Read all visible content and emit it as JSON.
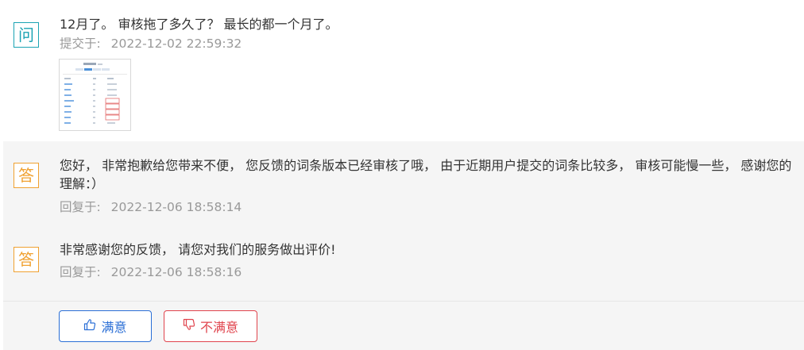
{
  "question": {
    "badge": "问",
    "text": "12月了。 审核拖了多久了？ 最长的都一个月了。",
    "submitted_label": "提交于:",
    "submitted_time": "2022-12-02 22:59:32"
  },
  "answers": [
    {
      "badge": "答",
      "text": "您好， 非常抱歉给您带来不便， 您反馈的词条版本已经审核了哦， 由于近期用户提交的词条比较多， 审核可能慢一些， 感谢您的理解：）",
      "replied_label": "回复于:",
      "replied_time": "2022-12-06 18:58:14"
    },
    {
      "badge": "答",
      "text": "非常感谢您的反馈， 请您对我们的服务做出评价!",
      "replied_label": "回复于:",
      "replied_time": "2022-12-06 18:58:16"
    }
  ],
  "rating": {
    "satisfied_label": "满意",
    "satisfied_icon": "thumbs-up-icon",
    "unsatisfied_label": "不满意",
    "unsatisfied_icon": "thumbs-down-icon"
  },
  "colors": {
    "question_accent": "#1ba3b3",
    "answer_accent": "#f0a131",
    "satisfied": "#2b6fd6",
    "unsatisfied": "#e0444d",
    "meta_text": "#999999",
    "answer_background": "#f5f5f5"
  }
}
